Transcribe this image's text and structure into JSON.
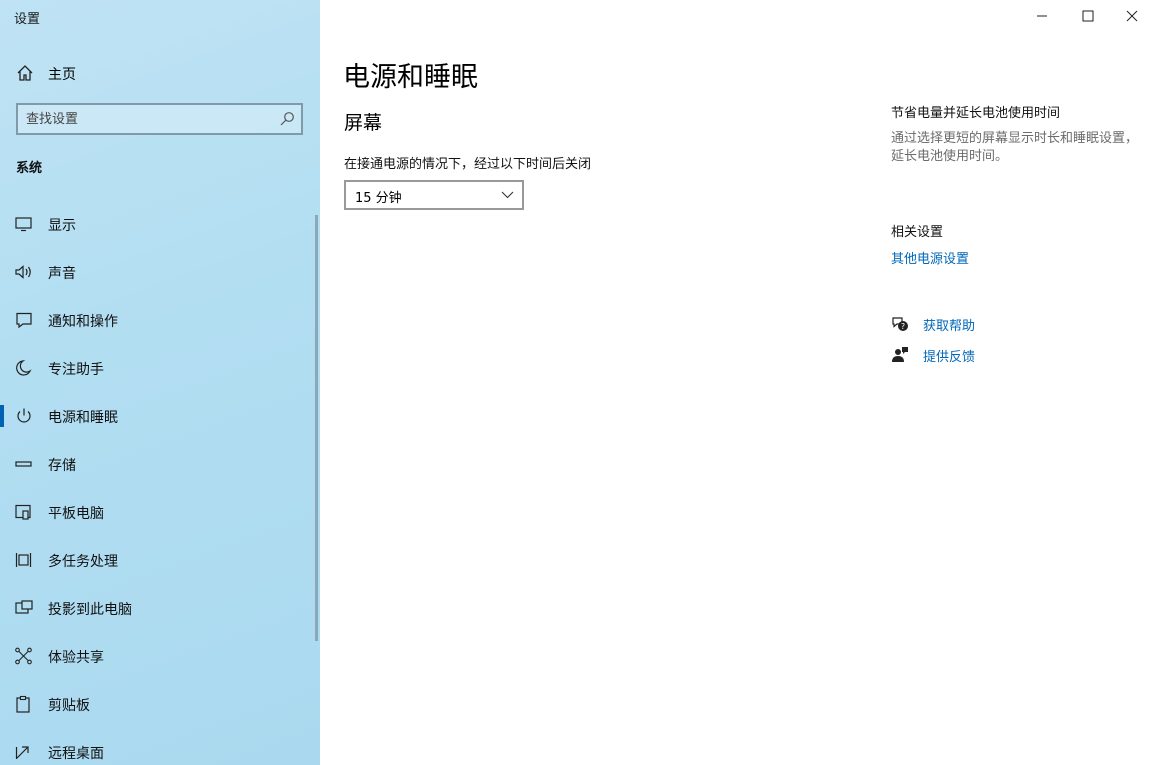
{
  "window": {
    "app_title": "设置",
    "minimize_label": "minimize",
    "maximize_label": "maximize",
    "close_label": "close"
  },
  "sidebar": {
    "home_label": "主页",
    "search_placeholder": "查找设置",
    "section_title": "系统",
    "items": [
      {
        "label": "显示",
        "icon": "monitor-icon"
      },
      {
        "label": "声音",
        "icon": "speaker-icon"
      },
      {
        "label": "通知和操作",
        "icon": "notification-icon"
      },
      {
        "label": "专注助手",
        "icon": "moon-icon"
      },
      {
        "label": "电源和睡眠",
        "icon": "power-icon",
        "active": true
      },
      {
        "label": "存储",
        "icon": "storage-icon"
      },
      {
        "label": "平板电脑",
        "icon": "tablet-icon"
      },
      {
        "label": "多任务处理",
        "icon": "multitask-icon"
      },
      {
        "label": "投影到此电脑",
        "icon": "project-icon"
      },
      {
        "label": "体验共享",
        "icon": "share-icon"
      },
      {
        "label": "剪贴板",
        "icon": "clipboard-icon"
      },
      {
        "label": "远程桌面",
        "icon": "remote-desktop-icon"
      }
    ]
  },
  "main": {
    "page_title": "电源和睡眠",
    "screen_heading": "屏幕",
    "plugged_in_label": "在接通电源的情况下，经过以下时间后关闭",
    "timeout_value": "15 分钟"
  },
  "right": {
    "battery_heading": "节省电量并延长电池使用时间",
    "battery_text": "通过选择更短的屏幕显示时长和睡眠设置，延长电池使用时间。",
    "related_heading": "相关设置",
    "related_link": "其他电源设置",
    "help_link": "获取帮助",
    "feedback_link": "提供反馈"
  },
  "colors": {
    "accent": "#0063b1",
    "link": "#0067b8",
    "sidebar_bg": "#b3def2"
  }
}
